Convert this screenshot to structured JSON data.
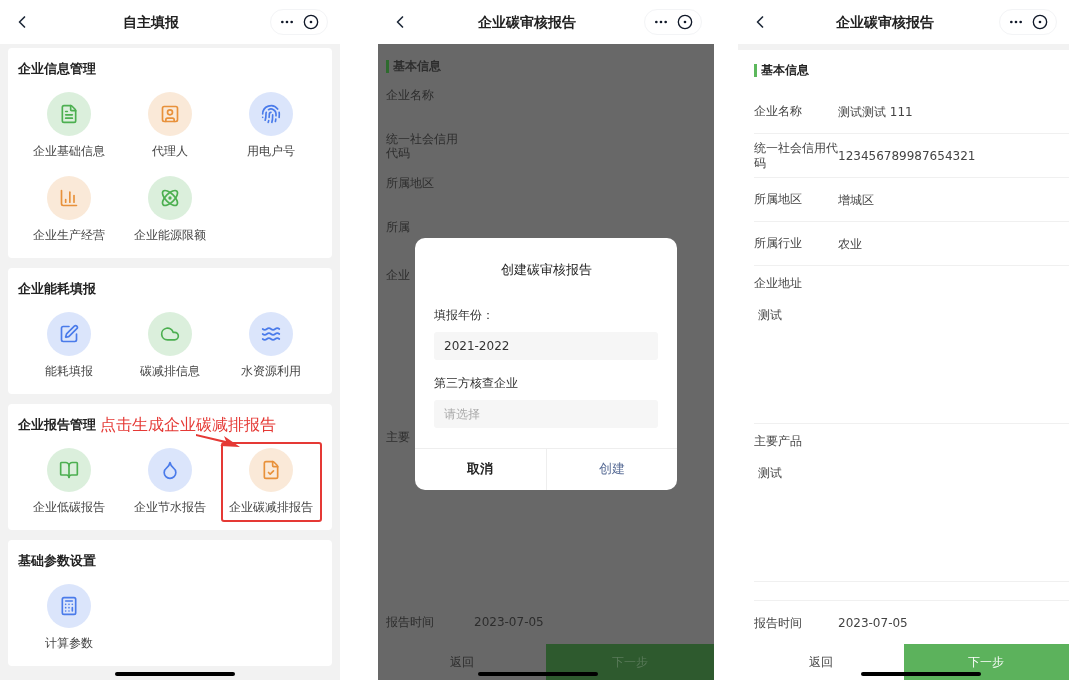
{
  "menu_screen": {
    "title": "自主填报",
    "sections": [
      {
        "title": "企业信息管理",
        "items": [
          {
            "label": "企业基础信息",
            "kind": "document",
            "color": "#4caf50",
            "highlighted": false
          },
          {
            "label": "代理人",
            "kind": "person",
            "color": "#e8913a",
            "highlighted": false
          },
          {
            "label": "用电户号",
            "kind": "id",
            "color": "#4a7bea",
            "highlighted": false
          },
          {
            "label": "企业生产经营",
            "kind": "chart",
            "color": "#e8913a",
            "highlighted": false
          },
          {
            "label": "企业能源限额",
            "kind": "atom",
            "color": "#4caf50",
            "highlighted": false
          }
        ]
      },
      {
        "title": "企业能耗填报",
        "items": [
          {
            "label": "能耗填报",
            "kind": "edit",
            "color": "#4a7bea",
            "highlighted": false
          },
          {
            "label": "碳减排信息",
            "kind": "cloud",
            "color": "#4caf50",
            "highlighted": false
          },
          {
            "label": "水资源利用",
            "kind": "waves",
            "color": "#4a7bea",
            "highlighted": false
          }
        ]
      },
      {
        "title": "企业报告管理",
        "annotation": "点击生成企业碳减排报告",
        "items": [
          {
            "label": "企业低碳报告",
            "kind": "book",
            "color": "#4caf50",
            "highlighted": false
          },
          {
            "label": "企业节水报告",
            "kind": "droplet",
            "color": "#4a7bea",
            "highlighted": false
          },
          {
            "label": "企业碳减排报告",
            "kind": "report",
            "color": "#e8913a",
            "highlighted": true
          }
        ]
      },
      {
        "title": "基础参数设置",
        "items": [
          {
            "label": "计算参数",
            "kind": "calculator",
            "color": "#4a7bea",
            "highlighted": false
          }
        ]
      }
    ]
  },
  "dialog_screen": {
    "title": "企业碳审核报告",
    "section": "基本信息",
    "rows": [
      {
        "label": "企业名称",
        "kind": "line"
      },
      {
        "label": "统一社会信用代码",
        "kind": "line"
      },
      {
        "label": "所属地区",
        "kind": "line"
      },
      {
        "label": "所属",
        "kind": "line"
      },
      {
        "label": "企业",
        "kind": "block"
      },
      {
        "label": "主要",
        "kind": "block"
      }
    ],
    "report_time": {
      "label": "报告时间",
      "value": "2023-07-05"
    },
    "back": "返回",
    "next": "下一步",
    "dialog": {
      "title": "创建碳审核报告",
      "fields": [
        {
          "label": "填报年份：",
          "value": "2021-2022"
        },
        {
          "label": "第三方核查企业",
          "placeholder": "请选择"
        }
      ],
      "cancel": "取消",
      "confirm": "创建"
    }
  },
  "detail_screen": {
    "title": "企业碳审核报告",
    "section": "基本信息",
    "rows": [
      {
        "label": "企业名称",
        "value": "测试测试 111",
        "kind": "line"
      },
      {
        "label": "统一社会信用代码",
        "value": "123456789987654321",
        "kind": "line"
      },
      {
        "label": "所属地区",
        "value": "增城区",
        "kind": "line"
      },
      {
        "label": "所属行业",
        "value": "农业",
        "kind": "line"
      },
      {
        "label": "企业地址",
        "value": "测试",
        "kind": "block"
      },
      {
        "label": "主要产品",
        "value": "测试",
        "kind": "block"
      }
    ],
    "report_time": {
      "label": "报告时间",
      "value": "2023-07-05"
    },
    "back": "返回",
    "next": "下一步"
  }
}
